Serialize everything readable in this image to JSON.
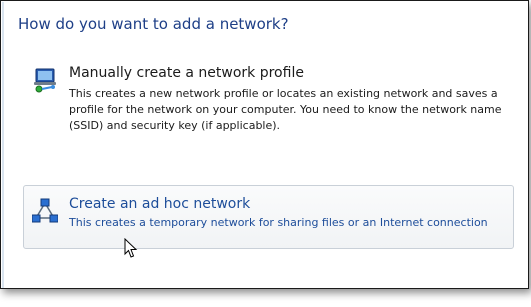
{
  "dialog": {
    "heading": "How do you want to add a network?"
  },
  "options": [
    {
      "title": "Manually create a network profile",
      "description": "This creates a new network profile or locates an existing network and saves a profile for the network on your computer. You need to know the network name (SSID) and security key (if applicable).",
      "icon": "network-computer-icon"
    },
    {
      "title": "Create an ad hoc network",
      "description": "This creates a temporary network for sharing files or an Internet connection",
      "icon": "adhoc-network-icon"
    }
  ],
  "colors": {
    "heading": "#1e3f87",
    "link": "#1d4d9a",
    "text": "#1b1b1b",
    "hover_border": "#c9d0d8"
  }
}
